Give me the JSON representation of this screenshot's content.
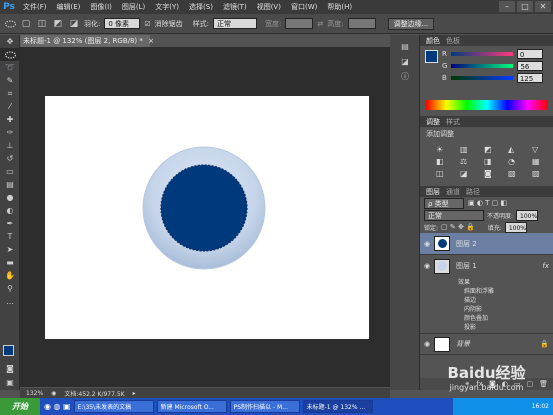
{
  "app": {
    "logo": "Ps",
    "window_buttons": [
      "–",
      "□",
      "✕"
    ]
  },
  "menus": [
    "文件(F)",
    "编辑(E)",
    "图像(I)",
    "图层(L)",
    "文字(Y)",
    "选择(S)",
    "滤镜(T)",
    "视图(V)",
    "窗口(W)",
    "帮助(H)"
  ],
  "options": {
    "feather_label": "羽化:",
    "feather_value": "0 像素",
    "antialias_label": "消除锯齿",
    "style_label": "样式:",
    "style_value": "正常",
    "width_label": "宽度:",
    "height_label": "高度:",
    "refine_button": "调整边缘..."
  },
  "document": {
    "tab_title": "未标题-1 @ 132% (图层 2, RGB/8) *",
    "tab_close": "×"
  },
  "status": {
    "zoom": "132%",
    "doc_size": "文档:452.2 K/977.5K"
  },
  "color_panel": {
    "tabs": [
      "颜色",
      "色板"
    ],
    "sliders": [
      {
        "label": "R",
        "value": "0"
      },
      {
        "label": "G",
        "value": "56"
      },
      {
        "label": "B",
        "value": "125"
      }
    ],
    "foreground": "#003a7d"
  },
  "adjust_panel": {
    "tabs": [
      "调整",
      "样式"
    ],
    "title": "添加调整",
    "icons": [
      "☀",
      "▥",
      "◩",
      "◭",
      "▽",
      "◧",
      "⚖",
      "◨",
      "◔",
      "▦",
      "◫",
      "◪",
      "◙",
      "▧",
      "▨"
    ]
  },
  "layers_panel": {
    "tabs": [
      "图层",
      "通道",
      "路径"
    ],
    "filter_label": "ρ 类型",
    "blend_mode": "正常",
    "opacity_label": "不透明度:",
    "opacity_value": "100%",
    "lock_label": "锁定:",
    "fill_label": "填充:",
    "fill_value": "100%",
    "layers": [
      {
        "name": "图层 2"
      },
      {
        "name": "图层 1"
      },
      {
        "name": "背景"
      }
    ],
    "effects_title": "效果",
    "effects": [
      "斜面和浮雕",
      "描边",
      "内阴影",
      "颜色叠加",
      "投影"
    ],
    "fx": "fx"
  },
  "taskbar": {
    "start": "开始",
    "tasks": [
      "E:\\35\\未发表的文稿",
      "新建 Microsoft O...",
      "PS制作扫描以 - M...",
      "未标题-1 @ 132% ..."
    ],
    "clock": "16:02",
    "watermark": "Baidu经验",
    "watermark_url": "jingyan.baidu.com"
  }
}
